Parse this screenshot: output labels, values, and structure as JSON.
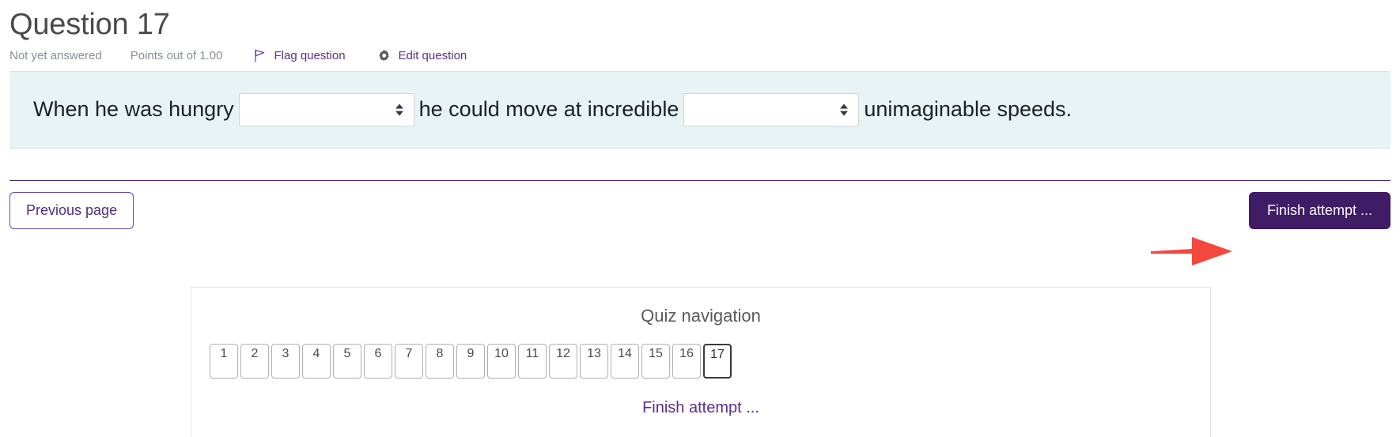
{
  "question": {
    "title": "Question 17",
    "status": "Not yet answered",
    "points": "Points out of 1.00",
    "flag_label": "Flag question",
    "flag_icon": "flag-icon",
    "edit_label": "Edit question",
    "edit_icon": "gear-icon",
    "text_fragments": [
      {
        "type": "text",
        "value": "When he was hungry"
      },
      {
        "type": "select",
        "value": "",
        "name": "blank-1"
      },
      {
        "type": "text",
        "value": "he could move at incredible"
      },
      {
        "type": "select",
        "value": "",
        "name": "blank-2"
      },
      {
        "type": "text",
        "value": "unimaginable speeds."
      }
    ],
    "fragment_1": "When he was hungry",
    "fragment_2": "he could move at incredible",
    "fragment_3": "unimaginable speeds."
  },
  "navigation": {
    "previous_page": "Previous page",
    "finish_attempt_button": "Finish attempt ..."
  },
  "quiz_navigation": {
    "title": "Quiz navigation",
    "questions": [
      {
        "number": "1",
        "current": false
      },
      {
        "number": "2",
        "current": false
      },
      {
        "number": "3",
        "current": false
      },
      {
        "number": "4",
        "current": false
      },
      {
        "number": "5",
        "current": false
      },
      {
        "number": "6",
        "current": false
      },
      {
        "number": "7",
        "current": false
      },
      {
        "number": "8",
        "current": false
      },
      {
        "number": "9",
        "current": false
      },
      {
        "number": "10",
        "current": false
      },
      {
        "number": "11",
        "current": false
      },
      {
        "number": "12",
        "current": false
      },
      {
        "number": "13",
        "current": false
      },
      {
        "number": "14",
        "current": false
      },
      {
        "number": "15",
        "current": false
      },
      {
        "number": "16",
        "current": false
      },
      {
        "number": "17",
        "current": true
      }
    ],
    "finish_attempt_link": "Finish attempt ..."
  },
  "annotations": {
    "arrow_color": "#f4483f",
    "arrow_to_finish_button": "red-arrow-pointing-right",
    "arrow_to_finish_link": "red-arrow-pointing-left"
  },
  "colors": {
    "brand_purple": "#401b66",
    "link_purple": "#5b2d8e",
    "question_bg": "#e7f3f4",
    "question_border": "#cfe6e8",
    "muted_text": "#868e96",
    "arrow_red": "#f4483f"
  }
}
